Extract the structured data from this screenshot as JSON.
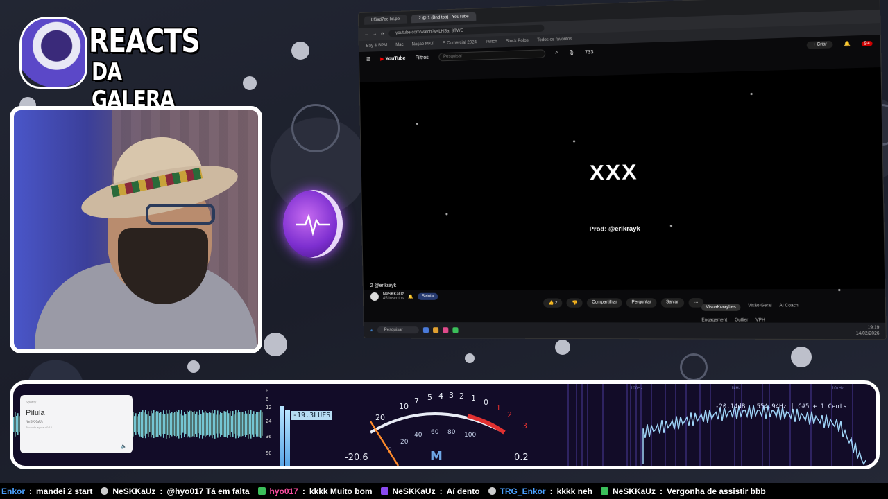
{
  "logo": {
    "line1": "REACTS",
    "line2": "DA GALERA"
  },
  "browser": {
    "tabs": [
      "bf6ad7ee-lxl.pel",
      "2 @ 1 (Bnd top) - YouTube"
    ],
    "url": "youtube.com/watch?v=LHSa_8TWE",
    "bookmarks": [
      "Bay & BPM",
      "Mac",
      "Nação MKT",
      "F. Comercial 2024",
      "Twitch",
      "Stock Polos",
      "Todos os favoritos"
    ],
    "yt_logo": "YouTube",
    "filter_chip": "Filtros",
    "search_placeholder": "Pesquisar",
    "create_label": "+ Criar",
    "counter": "733",
    "notif_badge": "9+"
  },
  "video": {
    "title": "XXX",
    "producer": "Prod: @erikrayk",
    "below_title": "2 @erikrayk",
    "channel_name": "NeSKKaUz",
    "channel_sub": "45 inscritos",
    "join_label": "Seinta",
    "likes": "2",
    "share_label": "Compartilhar",
    "ask_label": "Perguntar",
    "save_label": "Salvar",
    "side_tabs": [
      "VisuaKraxybes",
      "Visão Geral",
      "AI Coach"
    ],
    "side_labels": [
      "Engagement",
      "Outlier",
      "VPH"
    ]
  },
  "taskbar": {
    "search": "Pesquisar",
    "time": "19:19",
    "date": "14/02/2026"
  },
  "now_playing": {
    "header": "Spotify",
    "song": "Pílula",
    "artist": "NeSKKaUz",
    "progress": "Tocando agora • 0:12"
  },
  "loudness": {
    "scale": [
      "0",
      "6",
      "12",
      "24",
      "36",
      "50"
    ],
    "lufs": "-19.3LUFS"
  },
  "vu": {
    "top_ticks": [
      "20",
      "10",
      "7",
      "5",
      "4",
      "3",
      "2",
      "1",
      "0",
      "1",
      "2",
      "3"
    ],
    "bottom_ticks": [
      "0",
      "20",
      "40",
      "60",
      "80",
      "100"
    ],
    "left_value": "-20.6",
    "mode": "M",
    "right_value": "0.2"
  },
  "spectrum": {
    "freq_labels": [
      "100Hz",
      "1kHz",
      "10kHz"
    ],
    "readout": "-20.14dB | 554.94Hz | C#5 + 1 Cents"
  },
  "chat": [
    {
      "user": "Enkor",
      "msg": "mandei 2 start",
      "style": "blue"
    },
    {
      "user": "NeSKKaUz",
      "msg": "@hyo017 Tá em falta",
      "style": "white"
    },
    {
      "user": "hyo017",
      "msg": "kkkk  Muito bom",
      "style": "pink"
    },
    {
      "user": "NeSKKaUz",
      "msg": "Aí dento",
      "style": "white"
    },
    {
      "user": "TRG_Enkor",
      "msg": "kkkk  neh",
      "style": "blue"
    },
    {
      "user": "NeSKKaUz",
      "msg": "Vergonha de assistir bbb",
      "style": "white"
    }
  ],
  "colors": {
    "vu_red": "#e03030",
    "vu_orange": "#ff8a2a",
    "meter_blue": "#9fd4f7",
    "panel_bg": "#120c28"
  }
}
